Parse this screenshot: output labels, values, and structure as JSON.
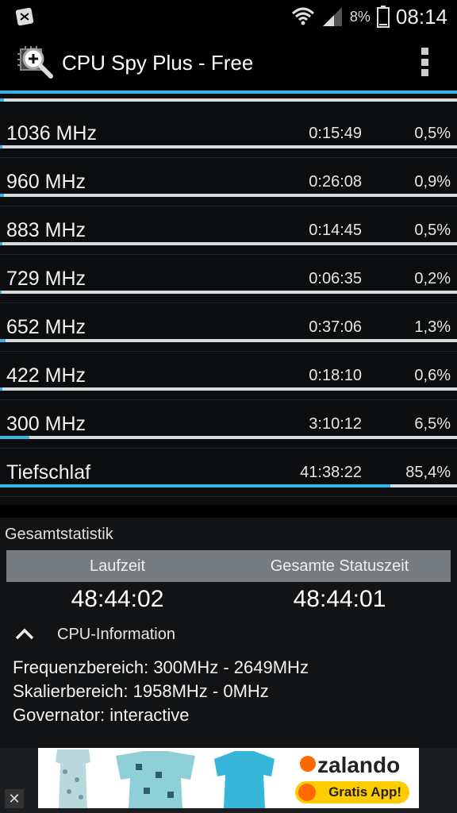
{
  "status_bar": {
    "battery_percent": "8%",
    "time": "08:14"
  },
  "app": {
    "title": "CPU Spy Plus - Free"
  },
  "colors": {
    "accent": "#33b5e5",
    "track": "#d8dcdc",
    "background": "#0b0d0f"
  },
  "states": [
    {
      "freq": "1036 MHz",
      "time": "0:15:49",
      "percent": "0,5%",
      "fill": 0.005
    },
    {
      "freq": "960 MHz",
      "time": "0:26:08",
      "percent": "0,9%",
      "fill": 0.009
    },
    {
      "freq": "883 MHz",
      "time": "0:14:45",
      "percent": "0,5%",
      "fill": 0.005
    },
    {
      "freq": "729 MHz",
      "time": "0:06:35",
      "percent": "0,2%",
      "fill": 0.002
    },
    {
      "freq": "652 MHz",
      "time": "0:37:06",
      "percent": "1,3%",
      "fill": 0.013
    },
    {
      "freq": "422 MHz",
      "time": "0:18:10",
      "percent": "0,6%",
      "fill": 0.006
    },
    {
      "freq": "300 MHz",
      "time": "3:10:12",
      "percent": "6,5%",
      "fill": 0.065
    },
    {
      "freq": "Tiefschlaf",
      "time": "41:38:22",
      "percent": "85,4%",
      "fill": 0.854
    }
  ],
  "summary": {
    "title": "Gesamtstatistik",
    "col1_label": "Laufzeit",
    "col2_label": "Gesamte Statuszeit",
    "col1_value": "48:44:02",
    "col2_value": "48:44:01"
  },
  "cpu_info": {
    "toggle_label": "CPU-Information",
    "freq_range": "Frequenzbereich: 300MHz - 2649MHz",
    "scaling_range": "Skalierbereich: 1958MHz - 0MHz",
    "governor": "Governator: interactive"
  },
  "ad": {
    "brand": "zalando",
    "cta": "Gratis App!",
    "close": "✕"
  }
}
